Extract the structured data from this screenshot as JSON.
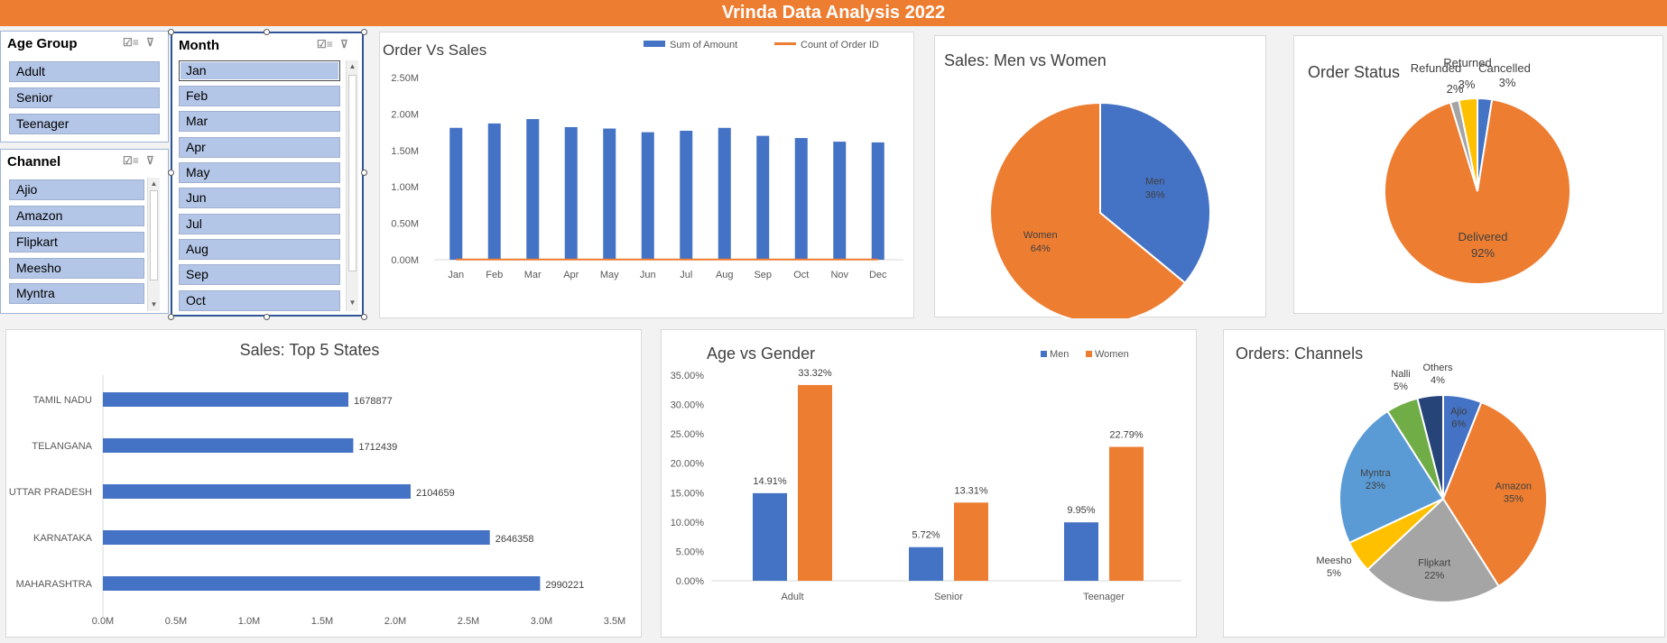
{
  "banner": {
    "title": "Vrinda Data Analysis 2022"
  },
  "colors": {
    "blue": "#4472c4",
    "orange": "#ed7d31",
    "gray": "#a5a5a5",
    "gold": "#ffc000",
    "lightblue": "#5b9bd5",
    "green": "#70ad47",
    "navy": "#264478",
    "slicer_item": "#b4c6e7",
    "banner": "#ed7d31"
  },
  "slicers": {
    "age": {
      "title": "Age Group",
      "items": [
        "Adult",
        "Senior",
        "Teenager"
      ]
    },
    "channel": {
      "title": "Channel",
      "items": [
        "Ajio",
        "Amazon",
        "Flipkart",
        "Meesho",
        "Myntra"
      ]
    },
    "month": {
      "title": "Month",
      "items": [
        "Jan",
        "Feb",
        "Mar",
        "Apr",
        "May",
        "Jun",
        "Jul",
        "Aug",
        "Sep",
        "Oct"
      ]
    }
  },
  "icons": {
    "multiselect": "multi-select-icon",
    "clear_filter": "clear-filter-icon",
    "scroll_up": "scroll-up-icon",
    "scroll_down": "scroll-down-icon"
  },
  "chart_data": [
    {
      "id": "order_vs_sales",
      "type": "bar",
      "title": "Order Vs Sales",
      "categories": [
        "Jan",
        "Feb",
        "Mar",
        "Apr",
        "May",
        "Jun",
        "Jul",
        "Aug",
        "Sep",
        "Oct",
        "Nov",
        "Dec"
      ],
      "series": [
        {
          "name": "Sum of Amount",
          "values": [
            1.81,
            1.87,
            1.93,
            1.82,
            1.8,
            1.75,
            1.77,
            1.81,
            1.7,
            1.67,
            1.62,
            1.61
          ]
        },
        {
          "name": "Count of Order ID",
          "values": [
            0.003,
            0.003,
            0.003,
            0.003,
            0.003,
            0.003,
            0.003,
            0.003,
            0.003,
            0.003,
            0.003,
            0.003
          ]
        }
      ],
      "yticks": [
        "0.00M",
        "0.50M",
        "1.00M",
        "1.50M",
        "2.00M",
        "2.50M"
      ],
      "ylim": [
        0,
        2.5
      ],
      "legend_position": "top"
    },
    {
      "id": "men_vs_women",
      "type": "pie",
      "title": "Sales: Men vs Women",
      "slices": [
        {
          "label": "Men",
          "pct_label": "36%",
          "value": 36
        },
        {
          "label": "Women",
          "pct_label": "64%",
          "value": 64
        }
      ]
    },
    {
      "id": "order_status",
      "type": "pie",
      "title": "Order Status",
      "slices": [
        {
          "label": "Cancelled",
          "pct_label": "3%",
          "value": 2.5
        },
        {
          "label": "Delivered",
          "pct_label": "92%",
          "value": 92.3
        },
        {
          "label": "Refunded",
          "pct_label": "2%",
          "value": 1.5
        },
        {
          "label": "Returned",
          "pct_label": "3%",
          "value": 3.2
        }
      ]
    },
    {
      "id": "top_states",
      "type": "bar",
      "orientation": "horizontal",
      "title": "Sales: Top 5 States",
      "categories": [
        "TAMIL NADU",
        "TELANGANA",
        "UTTAR PRADESH",
        "KARNATAKA",
        "MAHARASHTRA"
      ],
      "values": [
        1678877,
        1712439,
        2104659,
        2646358,
        2990221
      ],
      "value_labels": [
        "1678877",
        "1712439",
        "2104659",
        "2646358",
        "2990221"
      ],
      "xticks": [
        "0.0M",
        "0.5M",
        "1.0M",
        "1.5M",
        "2.0M",
        "2.5M",
        "3.0M",
        "3.5M"
      ],
      "xlim": [
        0,
        3500000
      ]
    },
    {
      "id": "age_vs_gender",
      "type": "bar",
      "title": "Age vs Gender",
      "categories": [
        "Adult",
        "Senior",
        "Teenager"
      ],
      "series": [
        {
          "name": "Men",
          "values": [
            14.91,
            5.72,
            9.95
          ],
          "labels": [
            "14.91%",
            "5.72%",
            "9.95%"
          ]
        },
        {
          "name": "Women",
          "values": [
            33.32,
            13.31,
            22.79
          ],
          "labels": [
            "33.32%",
            "13.31%",
            "22.79%"
          ]
        }
      ],
      "yticks": [
        "0.00%",
        "5.00%",
        "10.00%",
        "15.00%",
        "20.00%",
        "25.00%",
        "30.00%",
        "35.00%"
      ],
      "ylim": [
        0,
        35
      ],
      "legend_position": "top-right"
    },
    {
      "id": "channels",
      "type": "pie",
      "title": "Orders: Channels",
      "slices": [
        {
          "label": "Ajio",
          "pct_label": "6%",
          "value": 6
        },
        {
          "label": "Amazon",
          "pct_label": "35%",
          "value": 35
        },
        {
          "label": "Flipkart",
          "pct_label": "22%",
          "value": 22
        },
        {
          "label": "Meesho",
          "pct_label": "5%",
          "value": 5
        },
        {
          "label": "Myntra",
          "pct_label": "23%",
          "value": 23
        },
        {
          "label": "Nalli",
          "pct_label": "5%",
          "value": 5
        },
        {
          "label": "Others",
          "pct_label": "4%",
          "value": 4
        }
      ]
    }
  ]
}
